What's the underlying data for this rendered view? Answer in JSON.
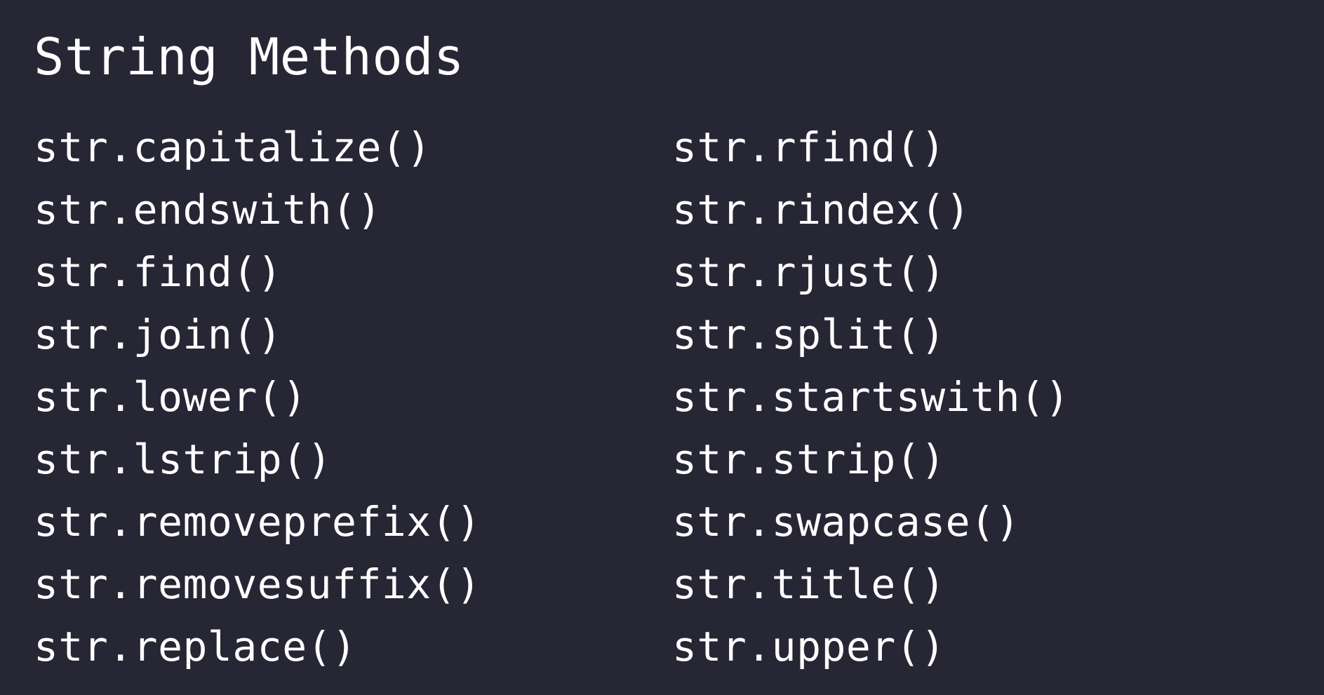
{
  "title": "String Methods",
  "colors": {
    "background": "#262635",
    "text": "#ffffff"
  },
  "methods": {
    "left": [
      "str.capitalize()",
      "str.endswith()",
      "str.find()",
      "str.join()",
      "str.lower()",
      "str.lstrip()",
      "str.removeprefix()",
      "str.removesuffix()",
      "str.replace()"
    ],
    "right": [
      "str.rfind()",
      "str.rindex()",
      "str.rjust()",
      "str.split()",
      "str.startswith()",
      "str.strip()",
      "str.swapcase()",
      "str.title()",
      "str.upper()"
    ]
  }
}
